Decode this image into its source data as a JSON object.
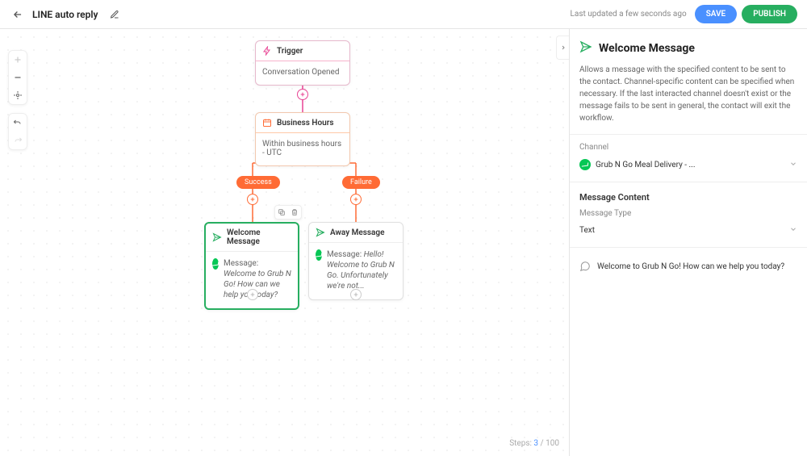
{
  "header": {
    "title": "LINE auto reply",
    "last_updated": "Last updated a few seconds ago",
    "save_label": "SAVE",
    "publish_label": "PUBLISH"
  },
  "canvas": {
    "steps_label_prefix": "Steps: ",
    "steps_current": "3",
    "steps_sep": " / ",
    "steps_max": "100"
  },
  "nodes": {
    "trigger": {
      "title": "Trigger",
      "body": "Conversation Opened"
    },
    "business_hours": {
      "title": "Business Hours",
      "body": "Within business hours - UTC"
    },
    "branch_success": "Success",
    "branch_failure": "Failure",
    "welcome": {
      "title": "Welcome Message",
      "msg_label": "Message: ",
      "msg_text": "Welcome to Grub N Go! How can we help  you today?"
    },
    "away": {
      "title": "Away Message",
      "msg_label": "Message: ",
      "msg_text": "Hello! Welcome to Grub N Go. Unfortunately we're not..."
    }
  },
  "panel": {
    "title": "Welcome Message",
    "description": "Allows a message with the specified content to be sent to the contact. Channel-specific content can be specified when necessary. If the last interacted channel doesn't exist or the message fails to be sent in general, the contact will exit the workflow.",
    "channel_label": "Channel",
    "channel_value": "Grub N Go Meal Delivery - ...",
    "content_title": "Message Content",
    "type_label": "Message Type",
    "type_value": "Text",
    "preview_text": "Welcome to Grub N Go! How can we help you today?"
  }
}
